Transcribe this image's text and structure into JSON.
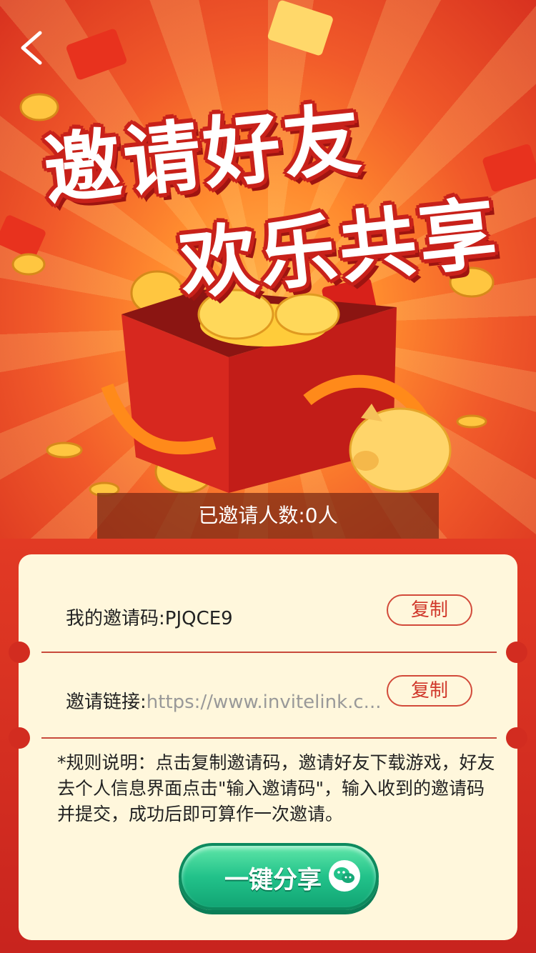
{
  "header": {
    "back_icon": "chevron-left-icon"
  },
  "banner": {
    "title_line1": "邀请好友",
    "title_line2": "欢乐共享"
  },
  "invite_count": {
    "text": "已邀请人数:0人"
  },
  "invite_code": {
    "label": "我的邀请码:PJQCE9",
    "copy_label": "复制"
  },
  "invite_link": {
    "label": "邀请链接:",
    "value": "https://www.invitelink.c...",
    "copy_label": "复制"
  },
  "rules": {
    "text": "*规则说明：点击复制邀请码，邀请好友下载游戏，好友去个人信息界面点击\"输入邀请码\"，输入收到的邀请码并提交，成功后即可算作一次邀请。"
  },
  "share": {
    "label": "一键分享",
    "icon": "wechat-icon"
  },
  "colors": {
    "primary_red": "#e23a24",
    "card_bg": "#fff7dc",
    "button_green": "#22c28a",
    "accent_text": "#d0372a"
  }
}
